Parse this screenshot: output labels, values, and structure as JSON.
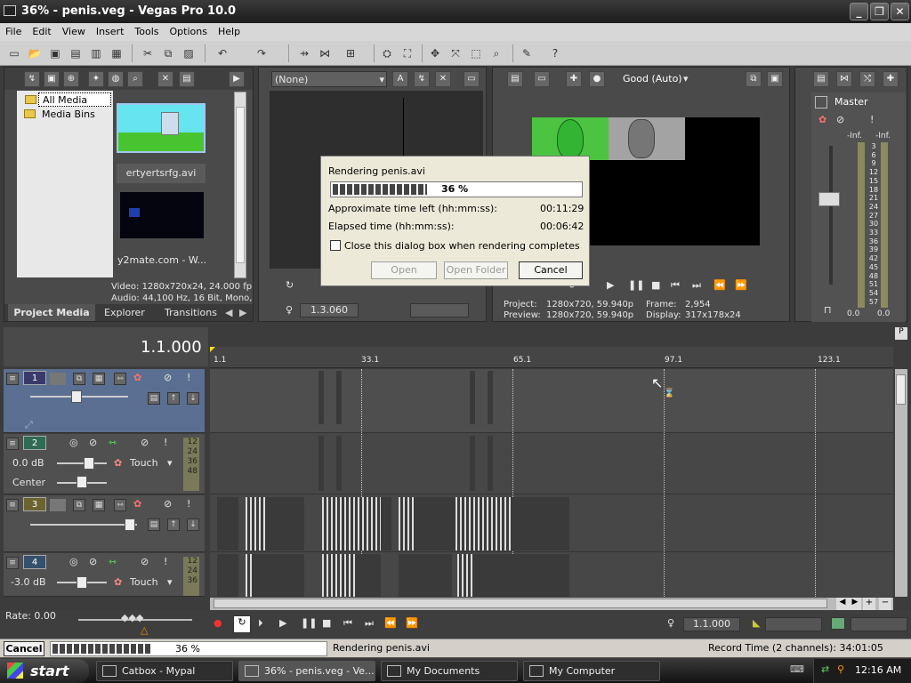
{
  "window": {
    "title": "36% - penis.veg - Vegas Pro 10.0"
  },
  "menu": [
    "File",
    "Edit",
    "View",
    "Insert",
    "Tools",
    "Options",
    "Help"
  ],
  "explorer": {
    "tree": [
      "All Media",
      "Media Bins"
    ],
    "media": [
      {
        "name": "ertyertsrfg.avi"
      },
      {
        "name": "y2mate.com - W..."
      }
    ],
    "info_video": "Video: 1280x720x24, 24.000 fp",
    "info_audio": "Audio: 44,100 Hz, 16 Bit, Mono,",
    "tabs": [
      "Project Media",
      "Explorer",
      "Transitions"
    ]
  },
  "trimmer": {
    "dropdown": "(None)",
    "time": "1.3.060"
  },
  "preview": {
    "quality": "Good (Auto)",
    "project_label": "Project:",
    "project": "1280x720, 59.940p",
    "frame_label": "Frame:",
    "frame": "2,954",
    "preview_label": "Preview:",
    "preview_val": "1280x720, 59.940p",
    "display_label": "Display:",
    "display": "317x178x24"
  },
  "mixer": {
    "label": "Master",
    "left": "-Inf.",
    "right": "-Inf.",
    "scale": [
      "3",
      "6",
      "9",
      "12",
      "15",
      "18",
      "21",
      "24",
      "27",
      "30",
      "33",
      "36",
      "39",
      "42",
      "45",
      "48",
      "51",
      "54",
      "57"
    ],
    "bottom_left": "0.0",
    "bottom_right": "0.0"
  },
  "timeline": {
    "cursor_time": "1.1.000",
    "ruler": [
      "1.1",
      "33.1",
      "65.1",
      "97.1",
      "123.1"
    ],
    "rate": "Rate: 0.00",
    "end_time": "1.1.000"
  },
  "tracks": [
    {
      "num": "1"
    },
    {
      "num": "2",
      "db": "0.0 dB",
      "mode": "Touch",
      "pan": "Center",
      "vu": [
        "12",
        "24",
        "36",
        "48"
      ]
    },
    {
      "num": "3"
    },
    {
      "num": "4",
      "db": "-3.0 dB",
      "mode": "Touch",
      "vu": [
        "12",
        "24",
        "36"
      ]
    }
  ],
  "dialog": {
    "title": "Rendering penis.avi",
    "percent": "36 %",
    "progress": 0.36,
    "left_label": "Approximate time left (hh:mm:ss):",
    "left": "00:11:29",
    "elapsed_label": "Elapsed time (hh:mm:ss):",
    "elapsed": "00:06:42",
    "checkbox": "Close this dialog box when rendering completes",
    "open": "Open",
    "open_folder": "Open Folder",
    "cancel": "Cancel"
  },
  "status": {
    "cancel": "Cancel",
    "percent": "36 %",
    "progress": 0.36,
    "message": "Rendering penis.avi",
    "record_time": "Record Time (2 channels): 34:01:05"
  },
  "taskbar": {
    "start": "start",
    "items": [
      "Catbox - Mypal",
      "36% - penis.veg - Ve...",
      "My Documents",
      "My Computer"
    ],
    "clock": "12:16 AM"
  },
  "colors": {
    "track1": "#3a3a6a",
    "track2": "#2f6b55",
    "track3": "#6b6330",
    "track4": "#34506b",
    "selected_track": "#5a6f91"
  }
}
